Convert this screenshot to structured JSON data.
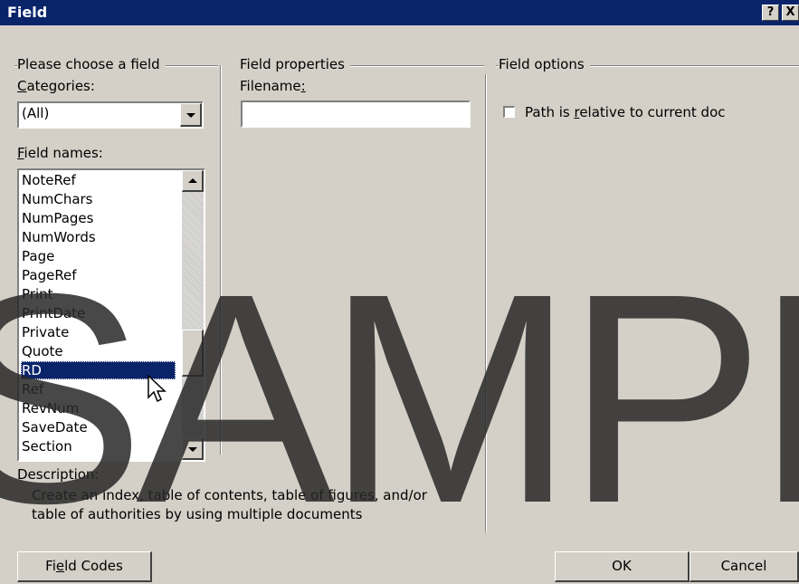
{
  "window": {
    "title": "Field",
    "help_btn": "?",
    "close_btn": "X"
  },
  "choose_group": {
    "label": "Please choose a field",
    "categories_label_pre": "",
    "categories_label_key": "C",
    "categories_label_post": "ategories:",
    "categories_value": "(All)",
    "field_names_label_key": "F",
    "field_names_label_post": "ield names:",
    "field_names": [
      "NoteRef",
      "NumChars",
      "NumPages",
      "NumWords",
      "Page",
      "PageRef",
      "Print",
      "PrintDate",
      "Private",
      "Quote",
      "RD",
      "Ref",
      "RevNum",
      "SaveDate",
      "Section"
    ],
    "selected_field": "RD"
  },
  "properties_group": {
    "label": "Field properties",
    "filename_label_pre": "Filename",
    "filename_label_key": ":",
    "filename_value": ""
  },
  "options_group": {
    "label": "Field options",
    "path_relative_pre": "Path is ",
    "path_relative_key": "r",
    "path_relative_post": "elative to current doc",
    "path_relative_checked": false
  },
  "description": {
    "label": "Description:",
    "line1": "Create an index, table of contents, table of figures, and/or",
    "line2": "table of authorities by using multiple documents"
  },
  "buttons": {
    "field_codes_pre": "Fi",
    "field_codes_key": "e",
    "field_codes_post": "ld Codes",
    "ok": "OK",
    "cancel": "Cancel"
  },
  "watermark": "SAMPLE"
}
